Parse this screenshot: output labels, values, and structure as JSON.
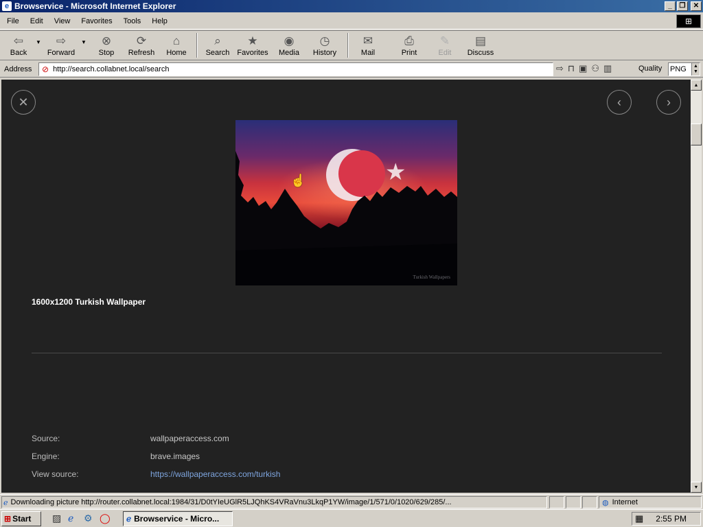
{
  "window": {
    "title": "Browservice - Microsoft Internet Explorer"
  },
  "menu": [
    "File",
    "Edit",
    "View",
    "Favorites",
    "Tools",
    "Help"
  ],
  "toolbar": {
    "back": "Back",
    "forward": "Forward",
    "stop": "Stop",
    "refresh": "Refresh",
    "home": "Home",
    "search": "Search",
    "favorites": "Favorites",
    "media": "Media",
    "history": "History",
    "mail": "Mail",
    "print": "Print",
    "edit": "Edit",
    "discuss": "Discuss"
  },
  "address": {
    "label": "Address",
    "url": "http://search.collabnet.local/search",
    "quality_label": "Quality",
    "quality_value": "PNG"
  },
  "viewer": {
    "title": "1600x1200 Turkish Wallpaper",
    "watermark": "Turkish Wallpapers",
    "meta": [
      {
        "key": "Source:",
        "value": "wallpaperaccess.com"
      },
      {
        "key": "Engine:",
        "value": "brave.images"
      },
      {
        "key": "View source:",
        "value": "https://wallpaperaccess.com/turkish"
      }
    ]
  },
  "status": {
    "text": "Downloading picture http://router.collabnet.local:1984/31/D0tYIeUGlR5LJQhKS4VRaVnu3LkqP1YW/image/1/571/0/1020/629/285/...",
    "zone": "Internet"
  },
  "taskbar": {
    "start": "Start",
    "task": "Browservice - Micro...",
    "clock": "2:55 PM"
  }
}
